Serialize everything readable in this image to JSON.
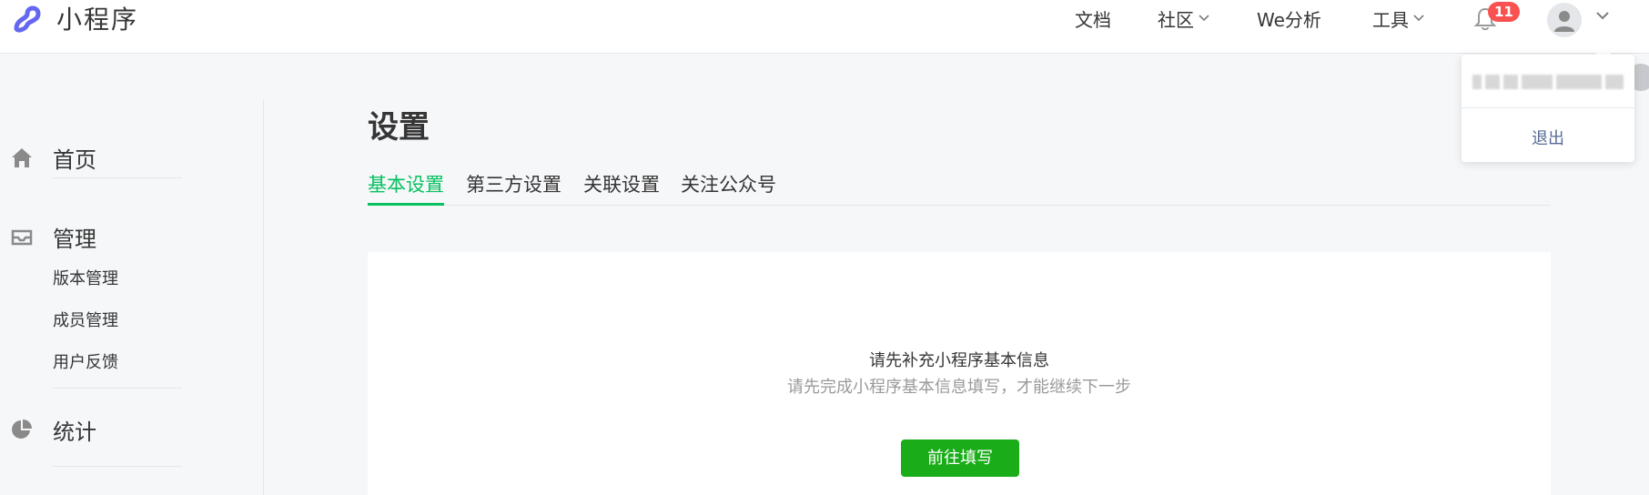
{
  "app": {
    "logo_text": "小程序"
  },
  "header": {
    "nav": [
      {
        "label": "文档",
        "has_chevron": false
      },
      {
        "label": "社区",
        "has_chevron": true
      },
      {
        "label": "We分析",
        "has_chevron": false
      },
      {
        "label": "工具",
        "has_chevron": true
      }
    ],
    "notification_count": "11",
    "bell_icon": "bell-icon",
    "avatar_icon": "user-avatar-icon"
  },
  "sidebar": {
    "home": {
      "label": "首页",
      "icon": "home-icon"
    },
    "manage": {
      "label": "管理",
      "icon": "inbox-icon",
      "items": [
        "版本管理",
        "成员管理",
        "用户反馈"
      ]
    },
    "stats": {
      "label": "统计",
      "icon": "pie-chart-icon"
    }
  },
  "main": {
    "title": "设置",
    "tabs": [
      "基本设置",
      "第三方设置",
      "关联设置",
      "关注公众号"
    ],
    "active_tab": "基本设置",
    "card": {
      "title": "请先补充小程序基本信息",
      "subtitle": "请先完成小程序基本信息填写，才能继续下一步",
      "button": "前往填写"
    }
  },
  "dropdown": {
    "logout": "退出"
  },
  "colors": {
    "accent_green": "#07c160",
    "button_green": "#1aad19",
    "badge_red": "#fa5151",
    "link_blue": "#576b95"
  }
}
